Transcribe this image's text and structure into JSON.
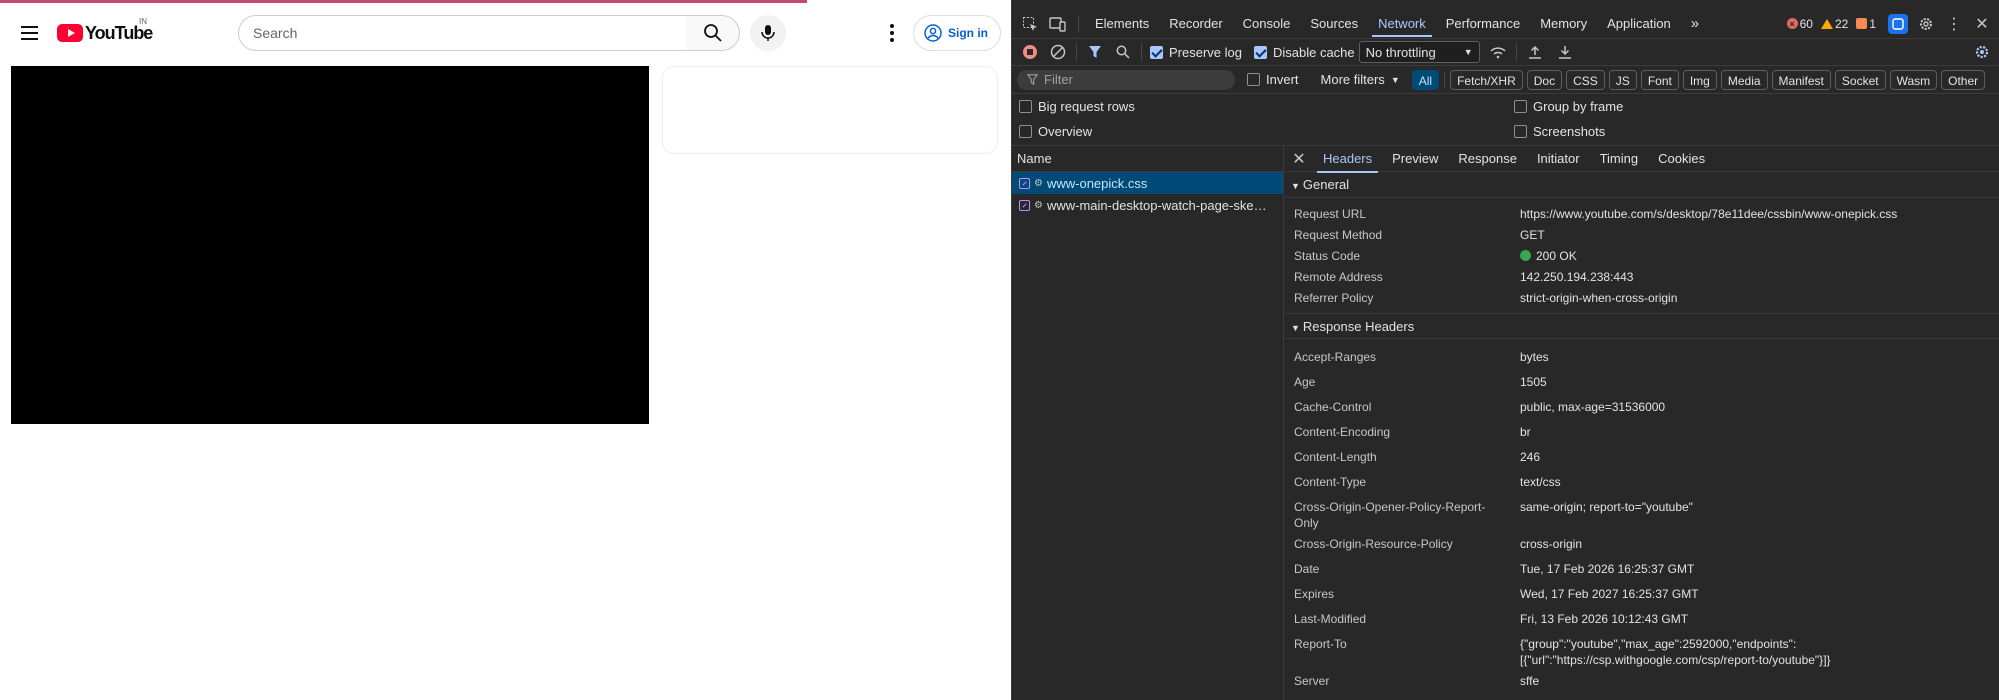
{
  "youtube": {
    "logo_word": "YouTube",
    "country": "IN",
    "search_placeholder": "Search",
    "signin_label": "Sign in"
  },
  "devtools": {
    "tabs": [
      "Elements",
      "Recorder",
      "Console",
      "Sources",
      "Network",
      "Performance",
      "Memory",
      "Application"
    ],
    "active_tab": "Network",
    "counts": {
      "errors": "60",
      "warnings": "22",
      "issues": "1"
    },
    "toolbar": {
      "preserve_log": "Preserve log",
      "disable_cache": "Disable cache",
      "throttling": "No throttling"
    },
    "filterbar": {
      "filter_placeholder": "Filter",
      "invert": "Invert",
      "more_filters": "More filters",
      "types": [
        "All",
        "Fetch/XHR",
        "Doc",
        "CSS",
        "JS",
        "Font",
        "Img",
        "Media",
        "Manifest",
        "Socket",
        "Wasm",
        "Other"
      ]
    },
    "options": {
      "big_request_rows": "Big request rows",
      "group_by_frame": "Group by frame",
      "overview": "Overview",
      "screenshots": "Screenshots"
    },
    "name_column": "Name",
    "requests": [
      "www-onepick.css",
      "www-main-desktop-watch-page-ske…"
    ],
    "detail_tabs": [
      "Headers",
      "Preview",
      "Response",
      "Initiator",
      "Timing",
      "Cookies"
    ],
    "general": {
      "title": "General",
      "rows": [
        {
          "k": "Request URL",
          "v": "https://www.youtube.com/s/desktop/78e11dee/cssbin/www-onepick.css"
        },
        {
          "k": "Request Method",
          "v": "GET"
        },
        {
          "k": "Status Code",
          "v": "200 OK"
        },
        {
          "k": "Remote Address",
          "v": "142.250.194.238:443"
        },
        {
          "k": "Referrer Policy",
          "v": "strict-origin-when-cross-origin"
        }
      ]
    },
    "response_headers": {
      "title": "Response Headers",
      "rows": [
        {
          "k": "Accept-Ranges",
          "v": "bytes"
        },
        {
          "k": "Age",
          "v": "1505"
        },
        {
          "k": "Cache-Control",
          "v": "public, max-age=31536000"
        },
        {
          "k": "Content-Encoding",
          "v": "br"
        },
        {
          "k": "Content-Length",
          "v": "246"
        },
        {
          "k": "Content-Type",
          "v": "text/css"
        },
        {
          "k": "Cross-Origin-Opener-Policy-Report-Only",
          "v": "same-origin; report-to=\"youtube\""
        },
        {
          "k": "Cross-Origin-Resource-Policy",
          "v": "cross-origin"
        },
        {
          "k": "Date",
          "v": "Tue, 17 Feb 2026 16:25:37 GMT"
        },
        {
          "k": "Expires",
          "v": "Wed, 17 Feb 2027 16:25:37 GMT"
        },
        {
          "k": "Last-Modified",
          "v": "Fri, 13 Feb 2026 10:12:43 GMT"
        },
        {
          "k": "Report-To",
          "v": "{\"group\":\"youtube\",\"max_age\":2592000,\"endpoints\":[{\"url\":\"https://csp.withgoogle.com/csp/report-to/youtube\"}]}"
        },
        {
          "k": "Server",
          "v": "sffe"
        }
      ]
    }
  }
}
